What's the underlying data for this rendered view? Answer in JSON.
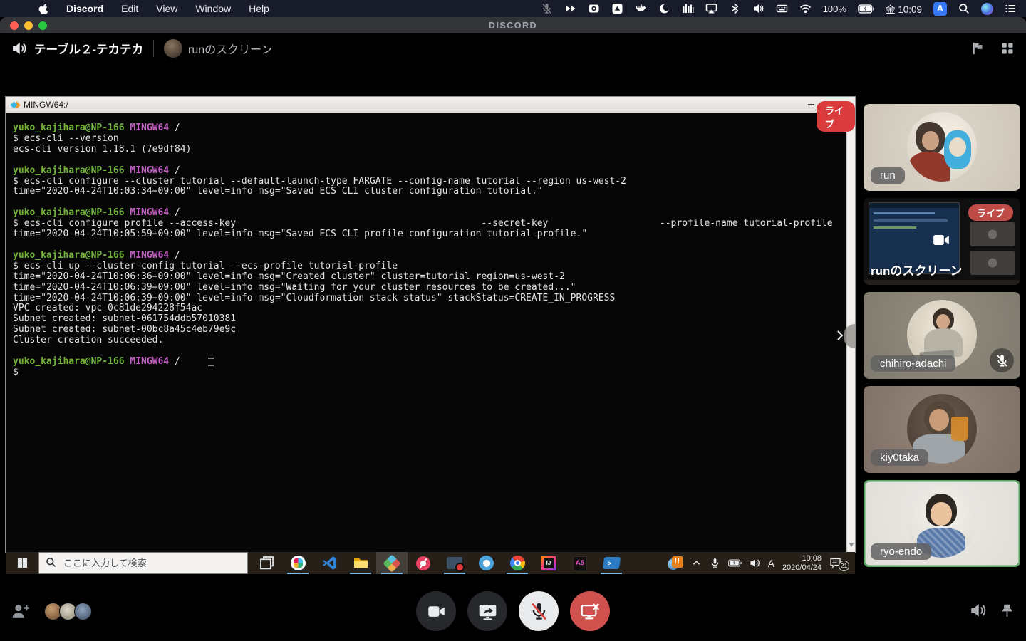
{
  "colors": {
    "live_red": "#da3b3d",
    "speaking_green": "#56a661",
    "disconnect_red": "#d0524e",
    "ime_blue": "#3478f6",
    "taskbar_underline": "#76b9ed",
    "prompt_green": "#72b33c",
    "prompt_magenta": "#c360c3"
  },
  "menubar": {
    "menus": [
      "Discord",
      "Edit",
      "View",
      "Window",
      "Help"
    ],
    "status_icons": [
      "mic-muted-icon",
      "double-chevron-icon",
      "screen-record-icon",
      "drive-icon",
      "docker-icon",
      "crescent-icon",
      "eq-bars-icon",
      "airplay-icon",
      "bluetooth-icon",
      "volume-icon",
      "keyboard-icon",
      "wifi-icon"
    ],
    "battery_percent": "100%",
    "clock": "金 10:09",
    "ime_badge": "A"
  },
  "window": {
    "titlebar_app": "DISCORD"
  },
  "channel_header": {
    "channel_name": "テーブル２-テカテカ",
    "stream_title": "runのスクリーン"
  },
  "terminal": {
    "title": "MINGW64:/",
    "live_badge": "ライブ",
    "lines": [
      [
        {
          "c": "g",
          "t": "yuko_kajihara@NP-166 "
        },
        {
          "c": "m",
          "t": "MINGW64"
        },
        {
          "c": "w",
          "t": " /"
        }
      ],
      [
        {
          "c": "w",
          "t": "$ ecs-cli --version"
        }
      ],
      [
        {
          "c": "w",
          "t": "ecs-cli version 1.18.1 (7e9df84)"
        }
      ],
      [],
      [
        {
          "c": "g",
          "t": "yuko_kajihara@NP-166 "
        },
        {
          "c": "m",
          "t": "MINGW64"
        },
        {
          "c": "w",
          "t": " /"
        }
      ],
      [
        {
          "c": "w",
          "t": "$ ecs-cli configure --cluster tutorial --default-launch-type FARGATE --config-name tutorial --region us-west-2"
        }
      ],
      [
        {
          "c": "w",
          "t": "time=\"2020-04-24T10:03:34+09:00\" level=info msg=\"Saved ECS CLI cluster configuration tutorial.\""
        }
      ],
      [],
      [
        {
          "c": "g",
          "t": "yuko_kajihara@NP-166 "
        },
        {
          "c": "m",
          "t": "MINGW64"
        },
        {
          "c": "w",
          "t": " /"
        }
      ],
      [
        {
          "c": "w",
          "t": "$ ecs-cli configure profile --access-key                                            --secret-key                    --profile-name tutorial-profile"
        }
      ],
      [
        {
          "c": "w",
          "t": "time=\"2020-04-24T10:05:59+09:00\" level=info msg=\"Saved ECS CLI profile configuration tutorial-profile.\""
        }
      ],
      [],
      [
        {
          "c": "g",
          "t": "yuko_kajihara@NP-166 "
        },
        {
          "c": "m",
          "t": "MINGW64"
        },
        {
          "c": "w",
          "t": " /"
        }
      ],
      [
        {
          "c": "w",
          "t": "$ ecs-cli up --cluster-config tutorial --ecs-profile tutorial-profile"
        }
      ],
      [
        {
          "c": "w",
          "t": "time=\"2020-04-24T10:06:36+09:00\" level=info msg=\"Created cluster\" cluster=tutorial region=us-west-2"
        }
      ],
      [
        {
          "c": "w",
          "t": "time=\"2020-04-24T10:06:39+09:00\" level=info msg=\"Waiting for your cluster resources to be created...\""
        }
      ],
      [
        {
          "c": "w",
          "t": "time=\"2020-04-24T10:06:39+09:00\" level=info msg=\"Cloudformation stack status\" stackStatus=CREATE_IN_PROGRESS"
        }
      ],
      [
        {
          "c": "w",
          "t": "VPC created: vpc-0c81de294228f54ac"
        }
      ],
      [
        {
          "c": "w",
          "t": "Subnet created: subnet-061754ddb57010381"
        }
      ],
      [
        {
          "c": "w",
          "t": "Subnet created: subnet-00bc8a45c4eb79e9c"
        }
      ],
      [
        {
          "c": "w",
          "t": "Cluster creation succeeded."
        }
      ],
      [],
      [
        {
          "c": "g",
          "t": "yuko_kajihara@NP-166 "
        },
        {
          "c": "m",
          "t": "MINGW64"
        },
        {
          "c": "w",
          "t": " /"
        }
      ],
      [
        {
          "c": "w",
          "t": "$"
        }
      ]
    ]
  },
  "windows_taskbar": {
    "search_placeholder": "ここに入力して検索",
    "apps": [
      {
        "name": "task-view",
        "icon": "task-view-icon",
        "open": false
      },
      {
        "name": "slack",
        "icon": "slack-icon",
        "open": true
      },
      {
        "name": "vscode",
        "icon": "vscode-icon",
        "open": false
      },
      {
        "name": "file-explorer",
        "icon": "file-explorer-icon",
        "open": true
      },
      {
        "name": "msys2-terminal",
        "icon": "msys2-icon",
        "open": true,
        "active": true
      },
      {
        "name": "snipping-tool",
        "icon": "snip-icon",
        "open": false
      },
      {
        "name": "screen-recorder",
        "icon": "recorder-icon",
        "open": true
      },
      {
        "name": "docker-desktop",
        "icon": "docker-desktop-icon",
        "open": false
      },
      {
        "name": "chrome",
        "icon": "chrome-icon",
        "open": true
      },
      {
        "name": "intellij-idea",
        "icon": "intellij-icon",
        "open": false
      },
      {
        "name": "a5-sql",
        "icon": "a5sql-icon",
        "open": false
      },
      {
        "name": "powershell",
        "icon": "powershell-icon",
        "open": true
      }
    ],
    "tray": {
      "alert": "!!",
      "ime": "A",
      "time": "10:08",
      "date": "2020/04/24",
      "notification_count": "21"
    }
  },
  "participants": [
    {
      "name": "run",
      "kind": "video",
      "slug": "run"
    },
    {
      "name": "runのスクリーン",
      "kind": "stream",
      "slug": "run-screen",
      "live_badge": "ライブ"
    },
    {
      "name": "chihiro-adachi",
      "kind": "video",
      "slug": "chihiro-adachi",
      "muted": true
    },
    {
      "name": "kiy0taka",
      "kind": "video",
      "slug": "kiy0taka"
    },
    {
      "name": "ryo-endo",
      "kind": "video",
      "slug": "ryo-endo",
      "speaking": true
    }
  ],
  "call_controls": {
    "buttons": [
      {
        "name": "camera-button",
        "icon": "camera-icon",
        "variant": "dark"
      },
      {
        "name": "screenshare-button",
        "icon": "screenshare-icon",
        "variant": "dark"
      },
      {
        "name": "mute-button",
        "icon": "mic-muted-dark-icon",
        "variant": "light"
      },
      {
        "name": "disconnect-button",
        "icon": "monitor-x-icon",
        "variant": "danger"
      }
    ]
  }
}
